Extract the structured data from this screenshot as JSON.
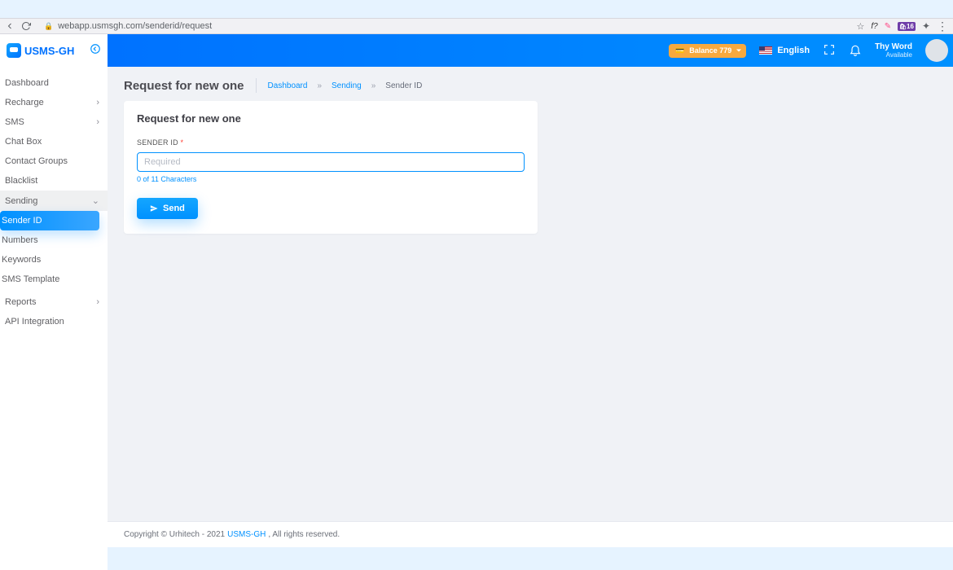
{
  "browser": {
    "url": "webapp.usmsgh.com/senderid/request",
    "ext_badge": "16"
  },
  "brand": {
    "text": "USMS-GH"
  },
  "nav": {
    "items": [
      {
        "label": "Dashboard",
        "expandable": false
      },
      {
        "label": "Recharge",
        "expandable": true
      },
      {
        "label": "SMS",
        "expandable": true
      },
      {
        "label": "Chat Box",
        "expandable": false
      },
      {
        "label": "Contact Groups",
        "expandable": false
      },
      {
        "label": "Blacklist",
        "expandable": false
      }
    ],
    "sending": {
      "label": "Sending",
      "children": [
        {
          "label": "Sender ID",
          "active": true
        },
        {
          "label": "Numbers",
          "active": false
        },
        {
          "label": "Keywords",
          "active": false
        },
        {
          "label": "SMS Template",
          "active": false
        }
      ]
    },
    "items_after": [
      {
        "label": "Reports",
        "expandable": true
      },
      {
        "label": "API Integration",
        "expandable": false
      }
    ]
  },
  "topbar": {
    "balance": "Balance 779",
    "language": "English",
    "user_name": "Thy Word",
    "user_status": "Available"
  },
  "page": {
    "title": "Request for new one",
    "crumbs": {
      "c1": "Dashboard",
      "c2": "Sending",
      "c3": "Sender ID"
    }
  },
  "card": {
    "heading": "Request for new one",
    "label": "SENDER ID",
    "required_mark": "*",
    "placeholder": "Required",
    "hint": "0 of 11 Characters",
    "button": "Send"
  },
  "footer": {
    "pre": "Copyright © Urhitech - 2021 ",
    "link": "USMS-GH",
    "post": ", All rights reserved."
  }
}
